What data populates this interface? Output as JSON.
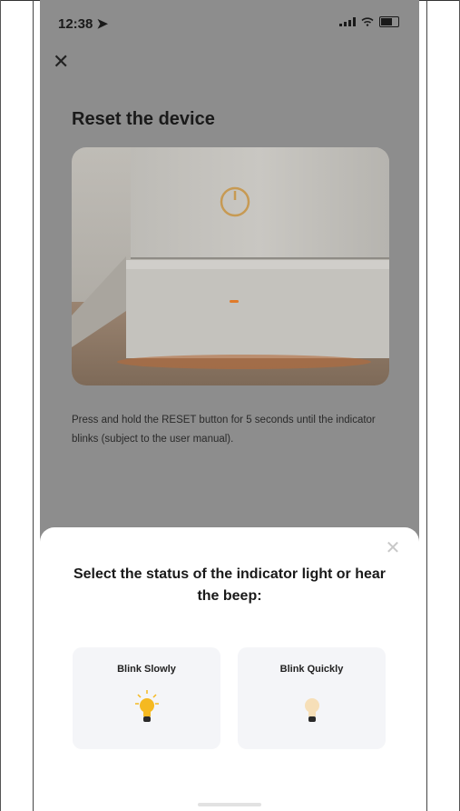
{
  "status_bar": {
    "time": "12:38"
  },
  "page": {
    "title": "Reset the device",
    "instruction": "Press and hold the RESET button for 5 seconds until the indicator blinks (subject to the user manual)."
  },
  "sheet": {
    "title": "Select the status of the indicator light or hear the beep:",
    "options": [
      {
        "label": "Blink Slowly",
        "icon": "bulb-lit-icon"
      },
      {
        "label": "Blink Quickly",
        "icon": "bulb-dim-icon"
      }
    ]
  },
  "colors": {
    "overlay": "#8d8d8d",
    "bulb_on": "#f5b921",
    "bulb_dim": "#f6dfb8"
  }
}
